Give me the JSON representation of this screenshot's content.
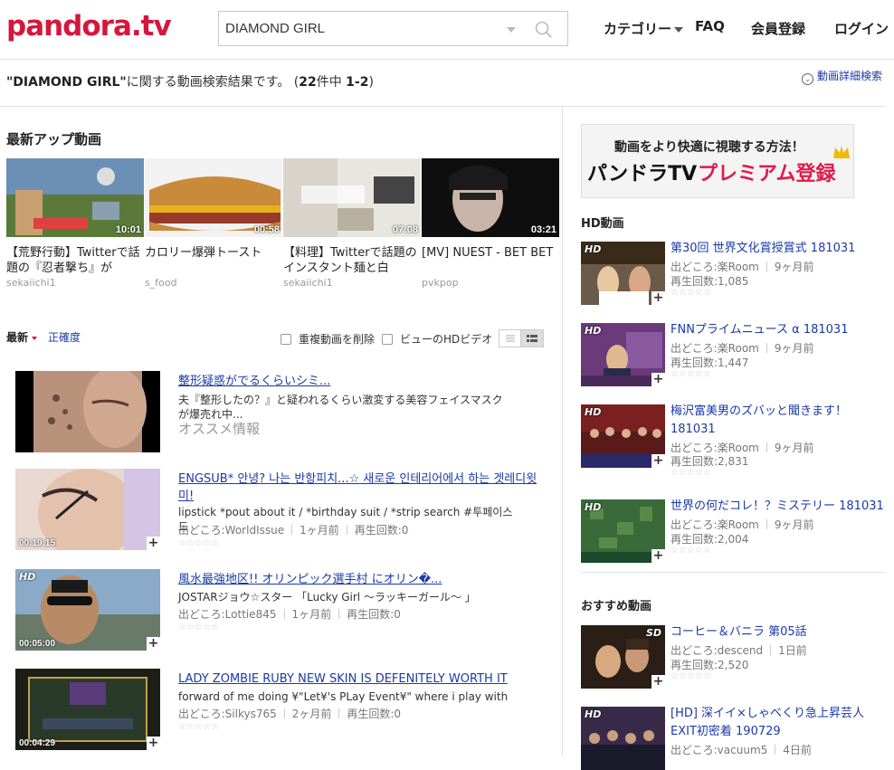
{
  "header": {
    "logo": "pandora.tv",
    "search_value": "DIAMOND GIRL",
    "nav": {
      "category": "カテゴリー",
      "faq": "FAQ",
      "register": "会員登録",
      "login": "ログイン"
    }
  },
  "summary": {
    "query": "\"DIAMOND GIRL\"",
    "text": "に関する動画検索結果です。 (",
    "total": "22",
    "unit": "件中 ",
    "range": "1-2",
    "close": ")",
    "advanced": "動画詳細検索"
  },
  "latest": {
    "title": "最新アップ動画",
    "items": [
      {
        "title": "【荒野行動】Twitterで話題の『忍者撃ち』が",
        "channel": "sekaiichi1",
        "duration": "10:01"
      },
      {
        "title": "カロリー爆弾トースト",
        "channel": "s_food",
        "duration": "00:58"
      },
      {
        "title": "【料理】Twitterで話題のインスタント麺と白",
        "channel": "sekaiichi1",
        "duration": "07:08"
      },
      {
        "title": "[MV] NUEST - BET BET",
        "channel": "pvkpop",
        "duration": "03:21"
      }
    ]
  },
  "sort": {
    "latest": "最新",
    "accuracy": "正確度",
    "dedupe": "重複動画を削除",
    "hd_only": "ビューのHDビデオ"
  },
  "results": [
    {
      "title": "整形疑惑がでるくらいシミ...",
      "desc": "夫『整形したの？』と疑われるくらい激変する美容フェイスマスクが爆売れ中...",
      "extra": "オススメ情報"
    },
    {
      "title": "ENGSUB* 안녕? 나는 반항피치...☆ 새로운 인테리어에서 하는 겟레디윗미!",
      "desc": "lipstick *pout about it / *birthday suit / *strip search #투페이스드",
      "source": "出どころ:WorldIssue",
      "age": "1ヶ月前",
      "views": "再生回数:0",
      "duration": "00:19:15"
    },
    {
      "title": "風水最強地区!! オリンピック選手村 にオリン�...",
      "desc": "JOSTARジョウ☆スター 「Lucky Girl ～ラッキーガール～ 」",
      "source": "出どころ:Lottie845",
      "age": "1ヶ月前",
      "views": "再生回数:0",
      "duration": "00:05:00",
      "badge": "HD"
    },
    {
      "title": "LADY ZOMBIE RUBY NEW SKIN IS DEFENITELY WORTH IT",
      "desc": "forward of me doing ¥\"Let¥'s PLay Event¥\" where i play with",
      "source": "出どころ:Silkys765",
      "age": "2ヶ月前",
      "views": "再生回数:0",
      "duration": "00:04:29"
    }
  ],
  "sidebar": {
    "ad_line1": "動画をより快適に視聴する方法！",
    "ad_line2": "パンドラTV",
    "ad_line3": "プレミアム登録",
    "hd_title": "HD動画",
    "hd_items": [
      {
        "title": "第30回 世界文化賞授賞式 181031",
        "source": "出どころ:楽Room",
        "age": "9ヶ月前",
        "views": "再生回数:1,085"
      },
      {
        "title": "FNNプライムニュース α 181031",
        "source": "出どころ:楽Room",
        "age": "9ヶ月前",
        "views": "再生回数:1,447"
      },
      {
        "title": "梅沢富美男のズバッと聞きます！181031",
        "source": "出どころ:楽Room",
        "age": "9ヶ月前",
        "views": "再生回数:2,831"
      },
      {
        "title": "世界の何だコレ！？ミステリー 181031",
        "source": "出どころ:楽Room",
        "age": "9ヶ月前",
        "views": "再生回数:2,004"
      }
    ],
    "rec_title": "おすすめ動画",
    "rec_items": [
      {
        "title": "コーヒー＆バニラ 第05話",
        "source": "出どころ:descend",
        "age": "1日前",
        "views": "再生回数:2,520",
        "badge": "SD"
      },
      {
        "title": "[HD] 深イイ×しゃべくり急上昇芸人EXIT初密着 190729",
        "source": "出どころ:vacuum5",
        "age": "4日前",
        "badge": "HD"
      }
    ]
  },
  "stars": "☆☆☆☆☆",
  "colors": {
    "brand": "#d6163c",
    "link": "#1a3aa8"
  }
}
